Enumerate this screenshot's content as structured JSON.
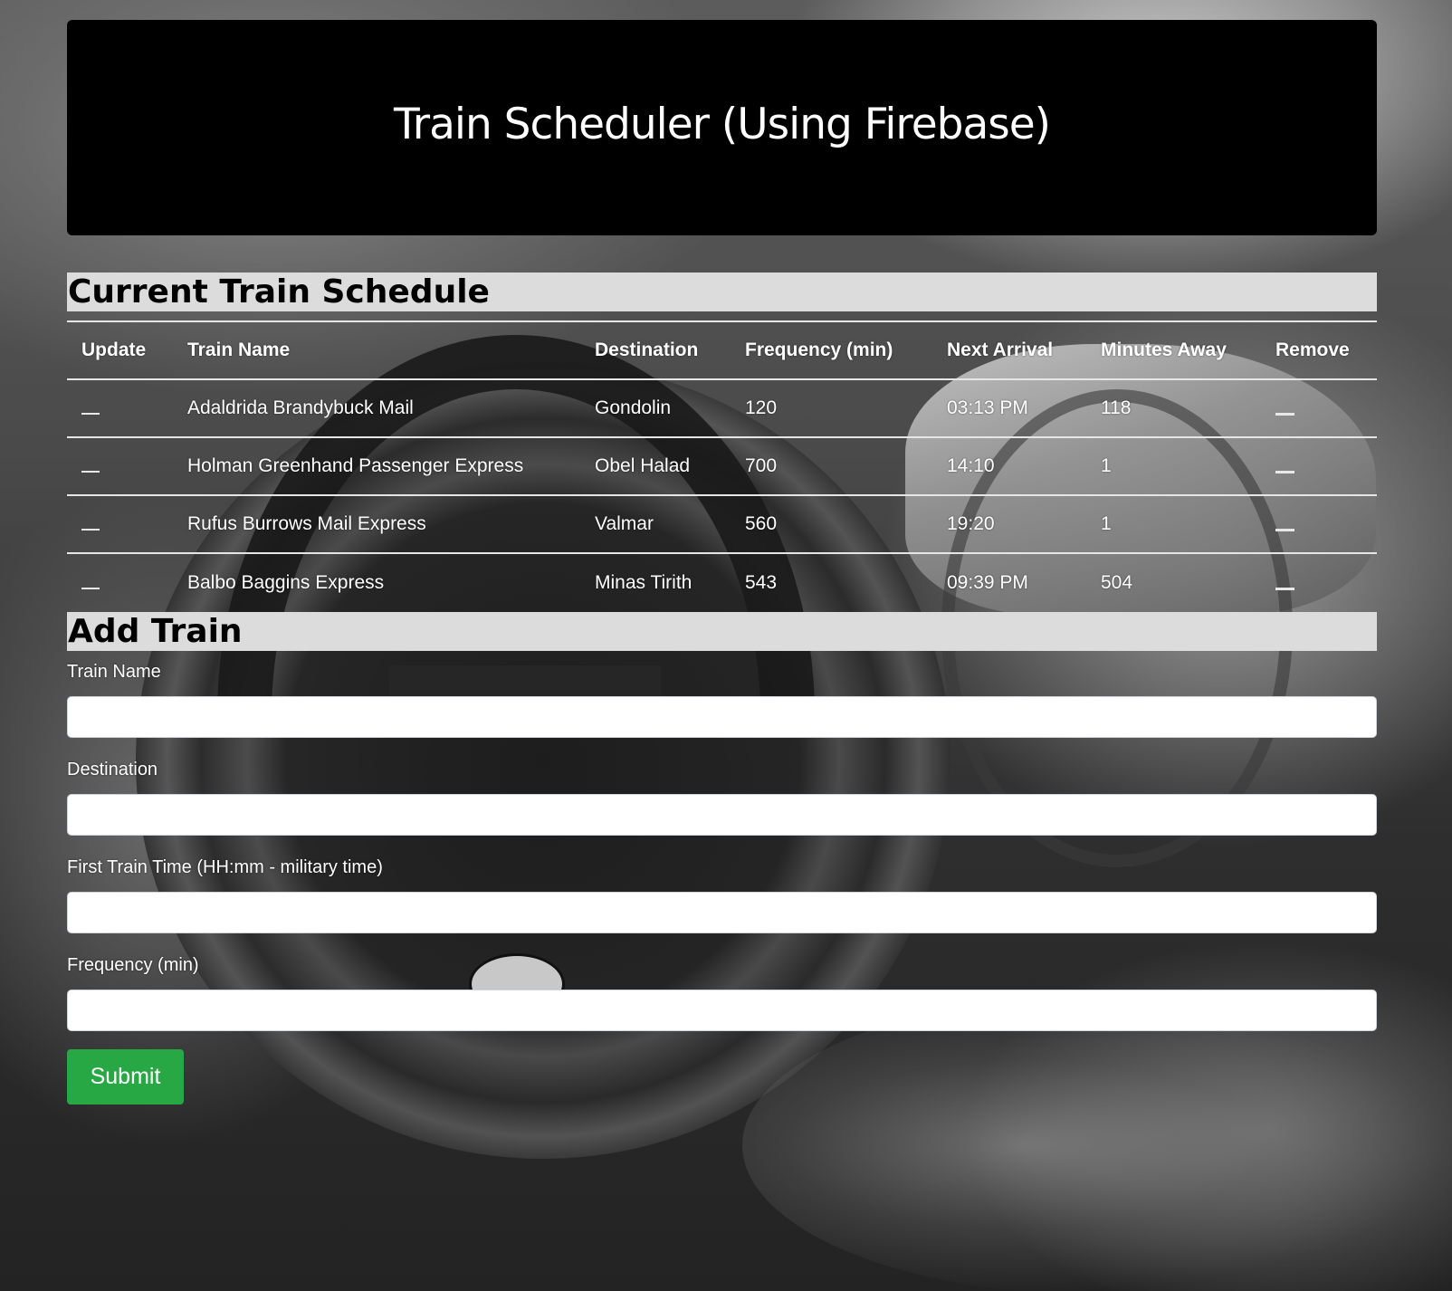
{
  "header": {
    "title": "Train Scheduler (Using Firebase)"
  },
  "schedule": {
    "title": "Current Train Schedule",
    "columns": [
      "Update",
      "Train Name",
      "Destination",
      "Frequency (min)",
      "Next Arrival",
      "Minutes Away",
      "Remove"
    ],
    "rows": [
      {
        "name": "Adaldrida Brandybuck Mail",
        "destination": "Gondolin",
        "frequency": "120",
        "next_arrival": "03:13 PM",
        "minutes_away": "118"
      },
      {
        "name": "Holman Greenhand Passenger Express",
        "destination": "Obel Halad",
        "frequency": "700",
        "next_arrival": "14:10",
        "minutes_away": "1"
      },
      {
        "name": "Rufus Burrows Mail Express",
        "destination": "Valmar",
        "frequency": "560",
        "next_arrival": "19:20",
        "minutes_away": "1"
      },
      {
        "name": "Balbo Baggins Express",
        "destination": "Minas Tirith",
        "frequency": "543",
        "next_arrival": "09:39 PM",
        "minutes_away": "504"
      }
    ]
  },
  "form": {
    "title": "Add Train",
    "fields": {
      "train_name": {
        "label": "Train Name",
        "value": ""
      },
      "destination": {
        "label": "Destination",
        "value": ""
      },
      "first_time": {
        "label": "First Train Time (HH:mm - military time)",
        "value": ""
      },
      "frequency": {
        "label": "Frequency (min)",
        "value": ""
      }
    },
    "submit_label": "Submit"
  },
  "colors": {
    "jumbotron_bg": "#000000",
    "section_title_bg": "#dcdcdc",
    "submit_bg": "#28a745"
  }
}
